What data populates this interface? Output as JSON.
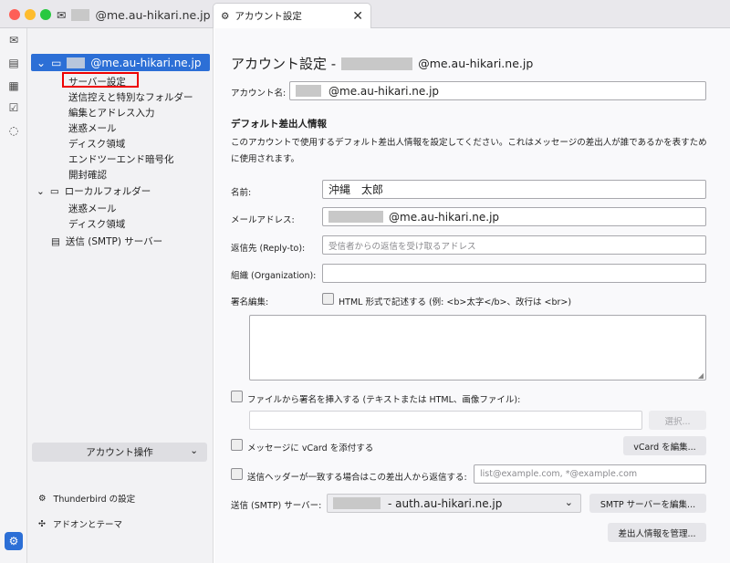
{
  "tabs": {
    "mail_tab": {
      "label": "@me.au-hikari.ne.jp"
    },
    "settings_tab": {
      "label": "アカウント設定",
      "close": "✕"
    }
  },
  "sidebar": {
    "account": {
      "label": "@me.au-hikari.ne.jp"
    },
    "account_items": [
      "サーバー設定",
      "送信控えと特別なフォルダー",
      "編集とアドレス入力",
      "迷惑メール",
      "ディスク領域",
      "エンドツーエンド暗号化",
      "開封確認"
    ],
    "local_folders": {
      "label": "ローカルフォルダー",
      "items": [
        "迷惑メール",
        "ディスク領域"
      ]
    },
    "smtp": {
      "label": "送信 (SMTP) サーバー"
    },
    "account_actions": "アカウント操作",
    "bottom": {
      "settings": "Thunderbird の設定",
      "addons": "アドオンとテーマ"
    }
  },
  "main": {
    "title_prefix": "アカウント設定 -",
    "title_suffix": "@me.au-hikari.ne.jp",
    "account_name": {
      "label": "アカウント名:",
      "value": "@me.au-hikari.ne.jp"
    },
    "section_title": "デフォルト差出人情報",
    "section_desc": "このアカウントで使用するデフォルト差出人情報を設定してください。これはメッセージの差出人が誰であるかを表すために使用されます。",
    "name": {
      "label": "名前:",
      "value": "沖縄　太郎"
    },
    "email": {
      "label": "メールアドレス:",
      "value": "@me.au-hikari.ne.jp"
    },
    "reply_to": {
      "label": "返信先 (Reply-to):",
      "placeholder": "受信者からの返信を受け取るアドレス"
    },
    "organization": {
      "label": "組織 (Organization):",
      "value": ""
    },
    "signature": {
      "label": "署名編集:",
      "html_checkbox": "HTML 形式で記述する (例: <b>太字</b>、改行は <br>)",
      "html_checked": false
    },
    "sig_file": {
      "label": "ファイルから署名を挿入する (テキストまたは HTML、画像ファイル):",
      "checked": false,
      "choose_button": "選択..."
    },
    "vcard": {
      "label": "メッセージに vCard を添付する",
      "checked": false,
      "edit_button": "vCard を編集..."
    },
    "reply_match": {
      "label": "送信ヘッダーが一致する場合はこの差出人から返信する:",
      "checked": false,
      "placeholder": "list@example.com, *@example.com"
    },
    "smtp": {
      "label": "送信 (SMTP) サーバー:",
      "value": "- auth.au-hikari.ne.jp",
      "edit_button": "SMTP サーバーを編集..."
    },
    "manage_identities_button": "差出人情報を管理..."
  }
}
